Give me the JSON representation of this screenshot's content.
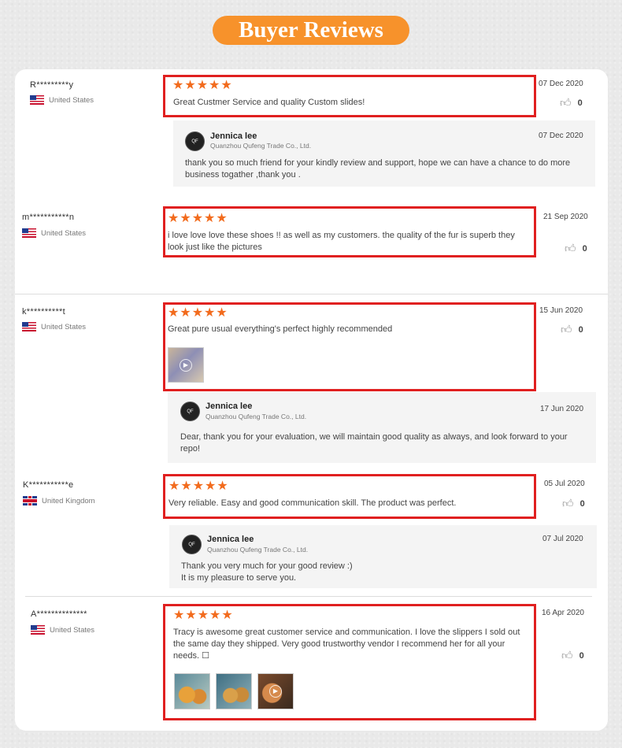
{
  "header": {
    "title": "Buyer Reviews"
  },
  "icons": {
    "like": "thumbs-up-icon",
    "play": "play-icon",
    "flag_us": "us-flag-icon",
    "flag_uk": "uk-flag-icon"
  },
  "colors": {
    "accent": "#f7922b",
    "stars": "#f26b1d",
    "highlight_box": "#e02020"
  },
  "reviews": [
    {
      "user": "R*********y",
      "country": "United States",
      "stars": "★★★★★",
      "text": "Great Custmer Service and quality Custom slides!",
      "date": "07 Dec 2020",
      "likes": "0",
      "reply": {
        "seller": "Jennica lee",
        "company": "Quanzhou Qufeng Trade Co., Ltd.",
        "date": "07 Dec 2020",
        "text": "thank you so much friend for your kindly review and support, hope we can have a chance to do more business togather ,thank you ."
      }
    },
    {
      "user": "m***********n",
      "country": "United States",
      "stars": "★★★★★",
      "text": "i love love love these shoes !! as well as my customers. the quality of the fur is superb they look just like the pictures",
      "date": "21 Sep 2020",
      "likes": "0"
    },
    {
      "user": "k**********t",
      "country": "United States",
      "stars": "★★★★★",
      "text": "Great pure usual everything's perfect highly recommended",
      "date": "15 Jun 2020",
      "likes": "0",
      "reply": {
        "seller": "Jennica lee",
        "company": "Quanzhou Qufeng Trade Co., Ltd.",
        "date": "17 Jun 2020",
        "text": "Dear, thank you for your evaluation, we will maintain good quality as always, and look forward to your repo!"
      }
    },
    {
      "user": "K***********e",
      "country": "United Kingdom",
      "stars": "★★★★★",
      "text": "Very reliable. Easy and good communication skill. The product was perfect.",
      "date": "05 Jul 2020",
      "likes": "0",
      "reply": {
        "seller": "Jennica lee",
        "company": "Quanzhou Qufeng Trade Co., Ltd.",
        "date": "07 Jul 2020",
        "text_line1": "Thank you very much for your good review :)",
        "text_line2": "It is my pleasure to serve you."
      }
    },
    {
      "user": "A**************",
      "country": "United States",
      "stars": "★★★★★",
      "text": "Tracy is awesome great customer service and communication. I love the slippers I sold out the same day they shipped. Very good trustworthy vendor I recommend her for all your needs. ☐",
      "date": "16 Apr 2020",
      "likes": "0"
    }
  ]
}
